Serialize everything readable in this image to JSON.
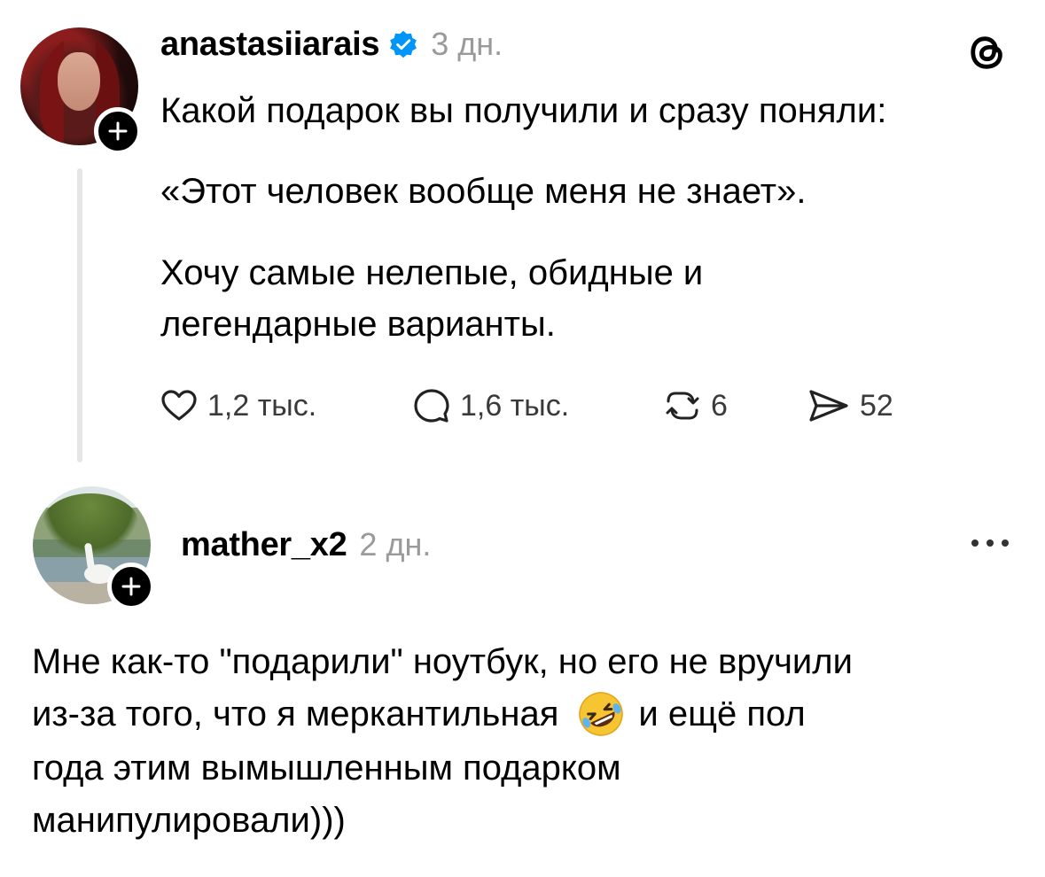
{
  "post": {
    "username": "anastasiiarais",
    "time": "3 дн.",
    "lines": [
      "Какой подарок вы получили и сразу поняли:",
      "«Этот человек вообще меня не знает».",
      "Хочу самые нелепые, обидные и",
      "легендарные варианты."
    ],
    "actions": {
      "likes": "1,2 тыс.",
      "comments": "1,6 тыс.",
      "reposts": "6",
      "shares": "52"
    }
  },
  "reply": {
    "username": "mather_x2",
    "time": "2 дн.",
    "lines": [
      "Мне как-то \"подарили\" ноутбук, но его не вручили",
      "из-за того, что я меркантильная",
      "и ещё пол",
      "года этим вымышленным подарком",
      "манипулировали)))"
    ]
  },
  "icons": {
    "verified": "verified-badge-icon",
    "threads_logo": "threads-logo-icon",
    "more": "more-icon",
    "emoji": "rolling-on-floor-laughing-emoji"
  },
  "colors": {
    "verified": "#0095f6",
    "muted": "#9a9a9a",
    "thread_line": "#e6e6e6"
  }
}
